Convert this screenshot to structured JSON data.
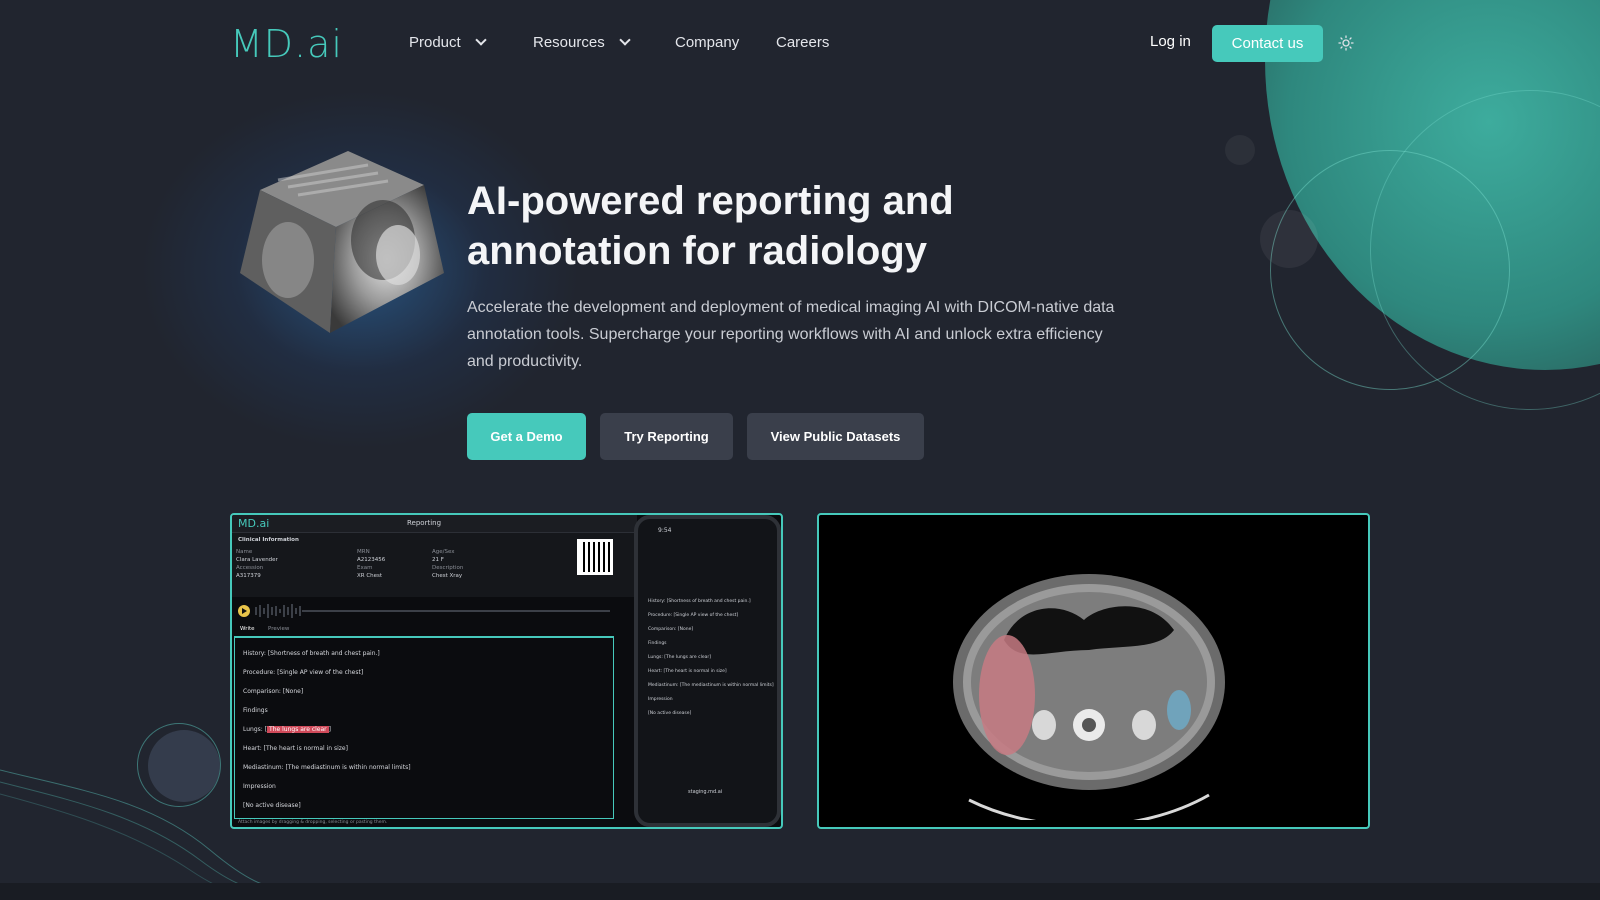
{
  "nav": {
    "logo": "MD.ai",
    "links": [
      {
        "label": "Product",
        "has_dropdown": true
      },
      {
        "label": "Resources",
        "has_dropdown": true
      },
      {
        "label": "Company",
        "has_dropdown": false
      },
      {
        "label": "Careers",
        "has_dropdown": false
      }
    ],
    "login": "Log in",
    "contact": "Contact us",
    "theme_icon": "sun-icon"
  },
  "hero": {
    "headline": "AI-powered reporting and annotation for radiology",
    "subtext": "Accelerate the development and deployment of medical imaging AI with DICOM-native data annotation tools. Supercharge your reporting workflows with AI and unlock extra efficiency and productivity.",
    "buttons": [
      "Get a Demo",
      "Try Reporting",
      "View Public Datasets"
    ]
  },
  "reporting_screenshot": {
    "logo": "MD.ai",
    "title": "Reporting",
    "section": "Clinical Information",
    "fields": [
      {
        "label": "Name",
        "value": "Clara Lavender"
      },
      {
        "label": "MRN",
        "value": "A2123456"
      },
      {
        "label": "Age/Sex",
        "value": "21 F"
      },
      {
        "label": "Accession",
        "value": "A317379"
      },
      {
        "label": "Exam",
        "value": "XR Chest"
      },
      {
        "label": "Description",
        "value": "Chest Xray"
      }
    ],
    "tabs": [
      "Write",
      "Preview"
    ],
    "report_lines": [
      "History: [Shortness of breath and chest pain.]",
      "Procedure: [Single AP view of the chest]",
      "Comparison: [None]",
      "Findings",
      "Lungs: [The lungs are clear]",
      "Heart: [The heart is normal in size]",
      "Mediastinum: [The mediastinum is within normal limits]",
      "Impression",
      "[No active disease]"
    ],
    "highlight": "The lungs are clear",
    "footer": "Attach images by dragging & dropping, selecting or pasting them.",
    "phone": {
      "time": "9:54",
      "url": "staging.md.ai",
      "lines": [
        "History: [Shortness of breath and chest pain.]",
        "Procedure: [Single AP view of the chest]",
        "Comparison: [None]",
        "Findings",
        "Lungs: [The lungs are clear]",
        "Heart: [The heart is normal in size]",
        "Mediastinum: [The mediastinum is within normal limits]",
        "Impression",
        "[No active disease]"
      ]
    }
  },
  "colors": {
    "accent": "#46c9bb",
    "background": "#21252f",
    "button_secondary": "#3a3f4b",
    "highlight": "#d04a5a"
  }
}
